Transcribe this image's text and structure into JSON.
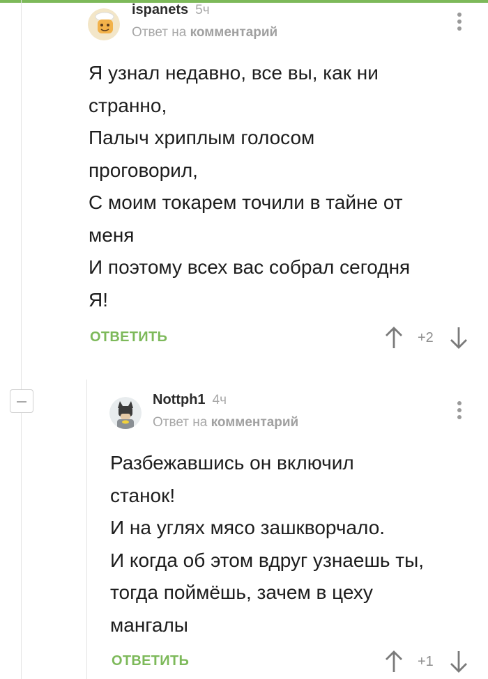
{
  "colors": {
    "accent": "#7db95a",
    "muted": "#a7a7a7",
    "text": "#1d1d1d"
  },
  "thread": {
    "collapse_icon": "minus-icon"
  },
  "comments": [
    {
      "author": "ispanets",
      "time": "5ч",
      "reply_prefix": "Ответ на",
      "reply_target": "комментарий",
      "avatar_icon": "cartoon-face-avatar",
      "lines": [
        "Я узнал недавно, все вы, как ни",
        "странно,",
        "Палыч хриплым голосом",
        "проговорил,",
        "С моим токарем точили в тайне от",
        "меня",
        "И поэтому всех вас собрал сегодня",
        "Я!"
      ],
      "reply_label": "ОТВЕТИТЬ",
      "score": "+2",
      "upvote_icon": "arrow-up-icon",
      "downvote_icon": "arrow-down-icon",
      "menu_icon": "more-vertical-icon"
    },
    {
      "author": "Nottph1",
      "time": "4ч",
      "reply_prefix": "Ответ на",
      "reply_target": "комментарий",
      "avatar_icon": "batman-avatar",
      "lines": [
        "Разбежавшись он включил",
        "станок!",
        "И на углях мясо зашкворчало.",
        "И когда об этом вдруг узнаешь ты,",
        "тогда поймёшь, зачем в цеху",
        "мангалы"
      ],
      "reply_label": "ОТВЕТИТЬ",
      "score": "+1",
      "upvote_icon": "arrow-up-icon",
      "downvote_icon": "arrow-down-icon",
      "menu_icon": "more-vertical-icon"
    }
  ]
}
